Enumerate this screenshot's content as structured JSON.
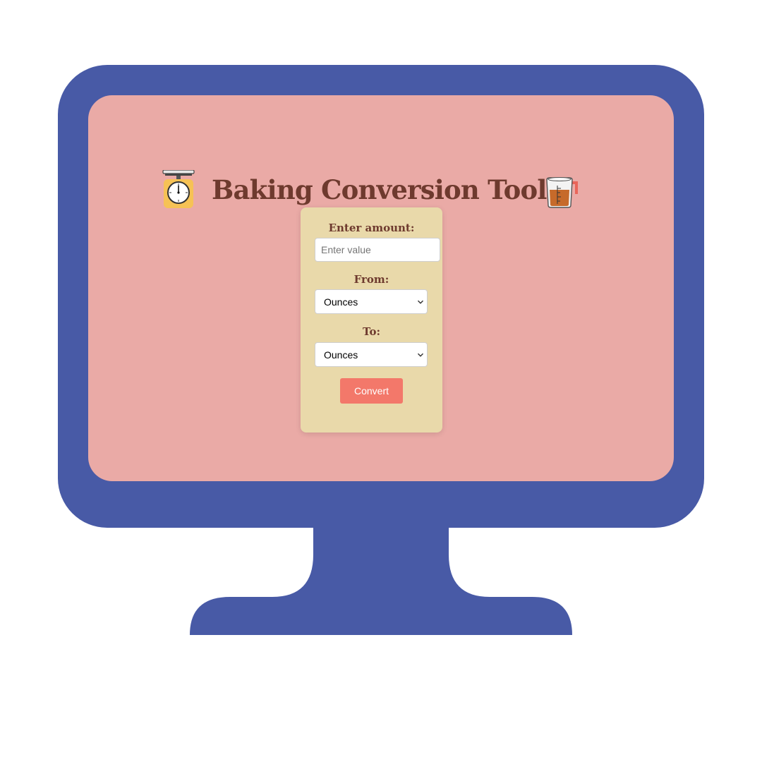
{
  "app": {
    "title": "Baking Conversion Tool",
    "title_icons": [
      "kitchen-scale-icon",
      "measuring-cup-icon"
    ]
  },
  "form": {
    "amount_label": "Enter amount:",
    "amount_placeholder": "Enter value",
    "amount_value": "",
    "from_label": "From:",
    "from_selected": "Ounces",
    "to_label": "To:",
    "to_selected": "Ounces",
    "convert_label": "Convert"
  },
  "colors": {
    "bezel": "#485aa6",
    "screen": "#eaaaa6",
    "card": "#e9d9aa",
    "title": "#6e3a2e",
    "accent": "#f3786a"
  }
}
